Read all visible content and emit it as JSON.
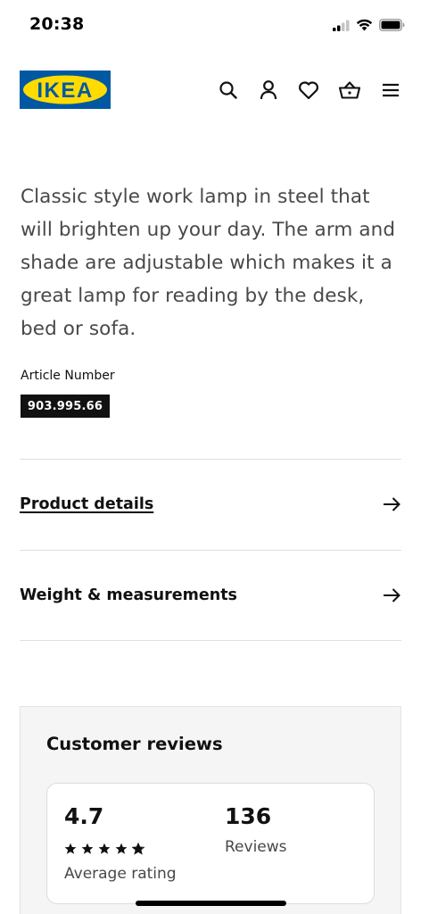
{
  "status_bar": {
    "time": "20:38",
    "icons": [
      "signal-icon",
      "wifi-icon",
      "battery-icon"
    ]
  },
  "header": {
    "logo_text": "IKEA",
    "icons": [
      "search-icon",
      "account-icon",
      "heart-icon",
      "basket-icon",
      "menu-icon"
    ]
  },
  "product": {
    "description": "Classic style work lamp in steel that will brighten up your day. The arm and shade are adjustable which makes it a great lamp for reading by the desk, bed or sofa.",
    "article_label": "Article Number",
    "article_number": "903.995.66"
  },
  "accordions": [
    {
      "label": "Product details",
      "icon": "arrow-right-icon"
    },
    {
      "label": "Weight & measurements",
      "icon": "arrow-right-icon"
    }
  ],
  "reviews": {
    "title": "Customer reviews",
    "rating": "4.7",
    "rating_stars": 4.7,
    "rating_caption": "Average rating",
    "count": "136",
    "count_caption": "Reviews"
  },
  "colors": {
    "ikea_blue": "#0058a3",
    "ikea_yellow": "#ffdb00",
    "text_dark": "#111111",
    "text_muted": "#484848",
    "reviews_bg": "#f5f5f5"
  }
}
